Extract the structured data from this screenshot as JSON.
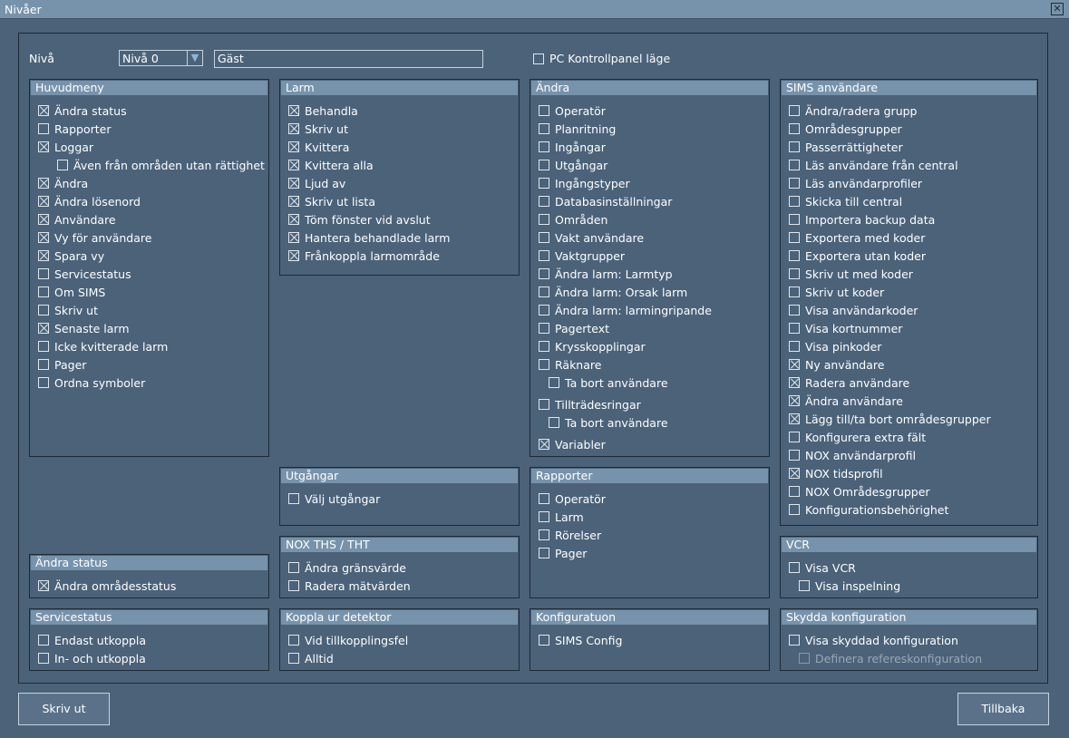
{
  "window": {
    "title": "Nivåer"
  },
  "top": {
    "level_label": "Nivå",
    "level_select": "Nivå 0",
    "name_value": "Gäst",
    "pc_mode_label": "PC Kontrollpanel läge",
    "pc_mode_checked": false
  },
  "groups": {
    "huvudmeny": {
      "title": "Huvudmeny",
      "items": [
        {
          "label": "Ändra status",
          "checked": true
        },
        {
          "label": "Rapporter",
          "checked": false
        },
        {
          "label": "Loggar",
          "checked": true
        },
        {
          "label": "Även från områden utan rättighet",
          "checked": false
        },
        {
          "label": "Ändra",
          "checked": true
        },
        {
          "label": "Ändra lösenord",
          "checked": true
        },
        {
          "label": "Användare",
          "checked": true
        },
        {
          "label": "Vy för användare",
          "checked": true
        },
        {
          "label": "Spara vy",
          "checked": true
        },
        {
          "label": "Servicestatus",
          "checked": false
        },
        {
          "label": "Om SIMS",
          "checked": false
        },
        {
          "label": "Skriv ut",
          "checked": false
        },
        {
          "label": "Senaste larm",
          "checked": true
        },
        {
          "label": "Icke kvitterade larm",
          "checked": false
        },
        {
          "label": "Pager",
          "checked": false
        },
        {
          "label": "Ordna symboler",
          "checked": false
        }
      ]
    },
    "larm": {
      "title": "Larm",
      "items": [
        {
          "label": "Behandla",
          "checked": true
        },
        {
          "label": "Skriv ut",
          "checked": true
        },
        {
          "label": "Kvittera",
          "checked": true
        },
        {
          "label": "Kvittera alla",
          "checked": true
        },
        {
          "label": "Ljud av",
          "checked": true
        },
        {
          "label": "Skriv ut lista",
          "checked": true
        },
        {
          "label": "Töm fönster vid avslut",
          "checked": true
        },
        {
          "label": "Hantera behandlade larm",
          "checked": true
        },
        {
          "label": "Frånkoppla larmområde",
          "checked": true
        }
      ]
    },
    "andra": {
      "title": "Ändra",
      "items": [
        {
          "label": "Operatör",
          "checked": false
        },
        {
          "label": "Planritning",
          "checked": false
        },
        {
          "label": "Ingångar",
          "checked": false
        },
        {
          "label": "Utgångar",
          "checked": false
        },
        {
          "label": "Ingångstyper",
          "checked": false
        },
        {
          "label": "Databasinställningar",
          "checked": false
        },
        {
          "label": "Områden",
          "checked": false
        },
        {
          "label": "Vakt användare",
          "checked": false
        },
        {
          "label": "Vaktgrupper",
          "checked": false
        },
        {
          "label": "Ändra larm: Larmtyp",
          "checked": false
        },
        {
          "label": "Ändra larm: Orsak larm",
          "checked": false
        },
        {
          "label": "Ändra larm: larmingripande",
          "checked": false
        },
        {
          "label": "Pagertext",
          "checked": false
        },
        {
          "label": "Krysskopplingar",
          "checked": false
        },
        {
          "label": "Räknare",
          "checked": false
        },
        {
          "label": "Ta bort användare",
          "checked": false
        },
        {
          "label": "Tillträdesringar",
          "checked": false
        },
        {
          "label": "Ta bort användare",
          "checked": false
        },
        {
          "label": "Variabler",
          "checked": true
        }
      ]
    },
    "sims": {
      "title": "SIMS användare",
      "items": [
        {
          "label": "Ändra/radera grupp",
          "checked": false
        },
        {
          "label": "Områdesgrupper",
          "checked": false
        },
        {
          "label": "Passerrättigheter",
          "checked": false
        },
        {
          "label": "Läs användare från central",
          "checked": false
        },
        {
          "label": "Läs användarprofiler",
          "checked": false
        },
        {
          "label": "Skicka till central",
          "checked": false
        },
        {
          "label": "Importera backup data",
          "checked": false
        },
        {
          "label": "Exportera med koder",
          "checked": false
        },
        {
          "label": "Exportera utan koder",
          "checked": false
        },
        {
          "label": "Skriv ut med koder",
          "checked": false
        },
        {
          "label": "Skriv ut koder",
          "checked": false
        },
        {
          "label": "Visa användarkoder",
          "checked": false
        },
        {
          "label": "Visa kortnummer",
          "checked": false
        },
        {
          "label": "Visa pinkoder",
          "checked": false
        },
        {
          "label": "Ny användare",
          "checked": true
        },
        {
          "label": "Radera användare",
          "checked": true
        },
        {
          "label": "Ändra användare",
          "checked": true
        },
        {
          "label": "Lägg till/ta bort områdesgrupper",
          "checked": true
        },
        {
          "label": "Konfigurera extra fält",
          "checked": false
        },
        {
          "label": "NOX användarprofil",
          "checked": false
        },
        {
          "label": "NOX tidsprofil",
          "checked": true
        },
        {
          "label": "NOX Områdesgrupper",
          "checked": false
        },
        {
          "label": "Konfigurationsbehörighet",
          "checked": false
        }
      ]
    },
    "utgangar": {
      "title": "Utgångar",
      "items": [
        {
          "label": "Välj utgångar",
          "checked": false
        }
      ]
    },
    "rapporter": {
      "title": "Rapporter",
      "items": [
        {
          "label": "Operatör",
          "checked": false
        },
        {
          "label": "Larm",
          "checked": false
        },
        {
          "label": "Rörelser",
          "checked": false
        },
        {
          "label": "Pager",
          "checked": false
        }
      ]
    },
    "nox": {
      "title": "NOX THS / THT",
      "items": [
        {
          "label": "Ändra gränsvärde",
          "checked": false
        },
        {
          "label": "Radera mätvärden",
          "checked": false
        }
      ]
    },
    "andra_status": {
      "title": "Ändra status",
      "items": [
        {
          "label": "Ändra områdesstatus",
          "checked": true
        }
      ]
    },
    "vcr": {
      "title": "VCR",
      "items": [
        {
          "label": "Visa VCR",
          "checked": false
        },
        {
          "label": "Visa inspelning",
          "checked": false
        }
      ]
    },
    "servicestatus": {
      "title": "Servicestatus",
      "items": [
        {
          "label": "Endast utkoppla",
          "checked": false
        },
        {
          "label": "In- och utkoppla",
          "checked": false
        }
      ]
    },
    "koppla": {
      "title": "Koppla ur detektor",
      "items": [
        {
          "label": "Vid tillkopplingsfel",
          "checked": false
        },
        {
          "label": "Alltid",
          "checked": false
        }
      ]
    },
    "konfig": {
      "title": "Konfiguratuon",
      "items": [
        {
          "label": "SIMS Config",
          "checked": false
        }
      ]
    },
    "skydda": {
      "title": "Skydda konfiguration",
      "items": [
        {
          "label": "Visa skyddad konfiguration",
          "checked": false
        },
        {
          "label": "Definera refereskonfiguration",
          "checked": false
        }
      ]
    }
  },
  "buttons": {
    "print": "Skriv ut",
    "back": "Tillbaka"
  }
}
